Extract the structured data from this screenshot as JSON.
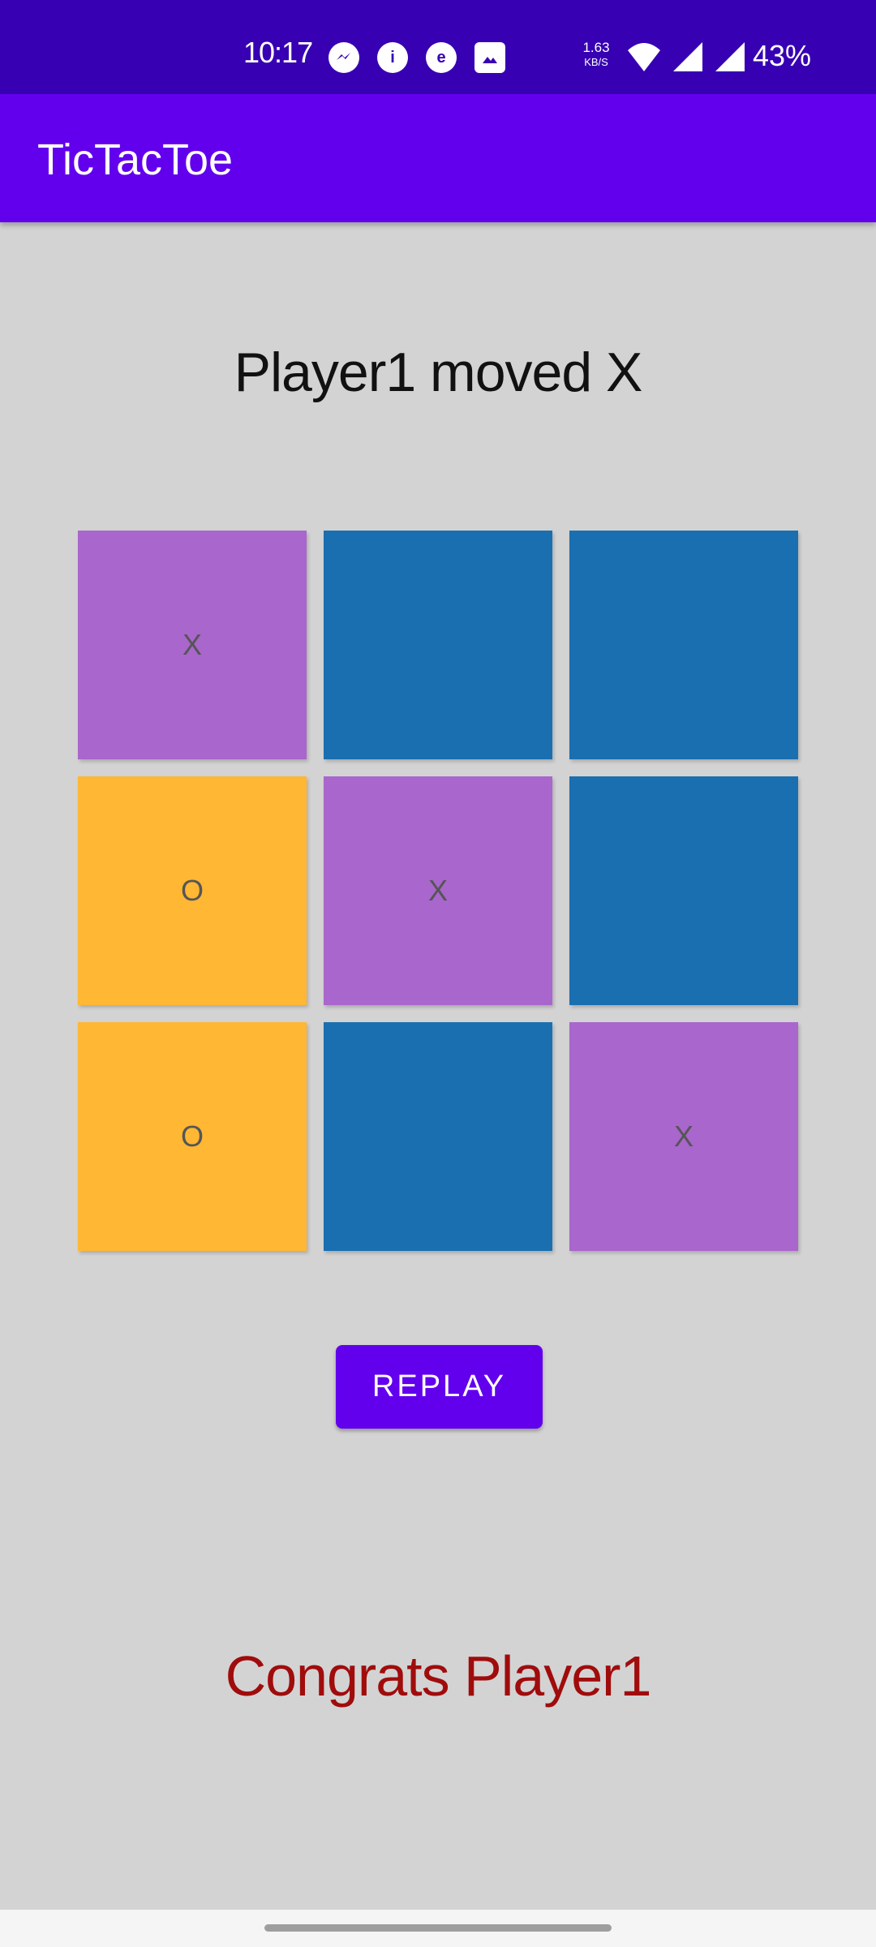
{
  "status_bar": {
    "time": "10:17",
    "notification_icons": [
      "messenger-icon",
      "app-icon",
      "browser-icon",
      "image-icon"
    ],
    "network_speed_value": "1.63",
    "network_speed_unit": "KB/S",
    "battery": "43%"
  },
  "app_bar": {
    "title": "TicTacToe"
  },
  "game": {
    "status": "Player1 moved X",
    "board": [
      {
        "mark": "X",
        "color": "#a966cc"
      },
      {
        "mark": "",
        "color": "#1a6fb0"
      },
      {
        "mark": "",
        "color": "#1a6fb0"
      },
      {
        "mark": "O",
        "color": "#ffb734"
      },
      {
        "mark": "X",
        "color": "#a966cc"
      },
      {
        "mark": "",
        "color": "#1a6fb0"
      },
      {
        "mark": "O",
        "color": "#ffb734"
      },
      {
        "mark": "",
        "color": "#1a6fb0"
      },
      {
        "mark": "X",
        "color": "#a966cc"
      }
    ],
    "replay_label": "REPLAY",
    "winner_text": "Congrats Player1"
  },
  "colors": {
    "status_bar": "#3700b3",
    "app_bar": "#6200ee",
    "background": "#d3d3d3",
    "winner_text": "#a00c0c"
  }
}
